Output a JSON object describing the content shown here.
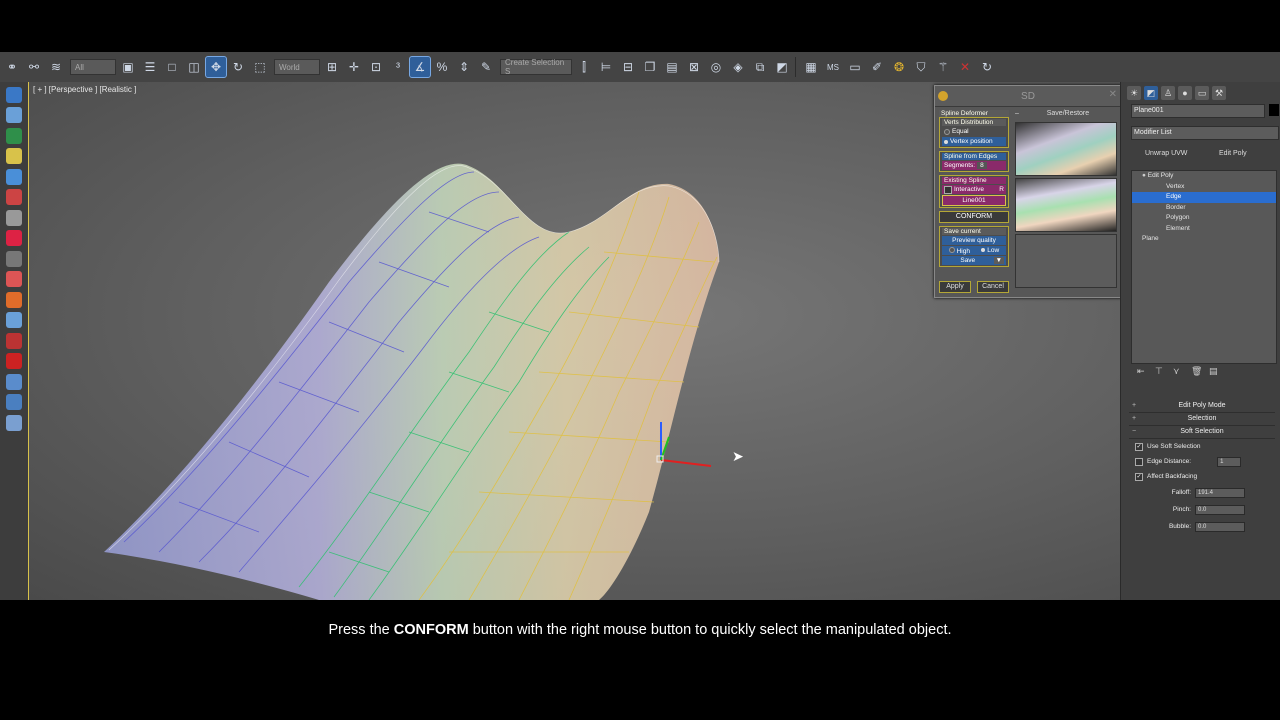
{
  "toolbar": {
    "selection_filter": "All",
    "ref_coord": "World",
    "named_selection": "Create Selection S",
    "icons": [
      "link-icon",
      "unlink-icon",
      "bind-icon",
      "select-icon",
      "select-by-name-icon",
      "rect-region-icon",
      "window-crossing-icon",
      "move-icon",
      "rotate-icon",
      "scale-icon",
      "pivot-icon",
      "snap-icon",
      "angle-snap-icon",
      "percent-snap-icon",
      "spinner-snap-icon",
      "edit-named-icon",
      "mirror-icon",
      "align-icon",
      "layers-icon",
      "graphite-icon",
      "curve-editor-icon",
      "schematic-icon",
      "material-editor-icon",
      "render-setup-icon",
      "render-frame-icon",
      "render-icon"
    ]
  },
  "viewport": {
    "label": "[ + ] [Perspective ] [Realistic ]"
  },
  "sd_window": {
    "title": "SD",
    "spline_deformer": "Spline Deformer",
    "verts_distribution": "Verts Distribution",
    "equal": "Equal",
    "vertex_position": "Vertex position",
    "spline_from_edges": "Spline from Edges",
    "segments": "Segments:",
    "segments_value": "8",
    "existing_spline": "Existing Spline",
    "interactive": "Interactive",
    "r_label": "R",
    "line_name": "Line001",
    "conform": "CONFORM",
    "save_current": "Save current",
    "preview_quality": "Preview quality",
    "high": "High",
    "low": "Low",
    "save": "Save",
    "apply": "Apply",
    "cancel": "Cancel",
    "save_restore": "Save/Restore",
    "minus": "–"
  },
  "command_panel": {
    "object_name": "Plane001",
    "modifier_list": "Modifier List",
    "unwrap_uvw": "Unwrap UVW",
    "edit_poly": "Edit Poly",
    "stack": {
      "edit_poly": "Edit Poly",
      "vertex": "Vertex",
      "edge": "Edge",
      "border": "Border",
      "polygon": "Polygon",
      "element": "Element",
      "plane": "Plane"
    },
    "rollouts": {
      "edit_poly_mode": "Edit Poly Mode",
      "selection": "Selection",
      "soft_selection": "Soft Selection"
    },
    "soft": {
      "use_soft_selection": "Use Soft Selection",
      "edge_distance": "Edge Distance:",
      "edge_distance_value": "1",
      "affect_backfacing": "Affect Backfacing",
      "falloff": "Falloff:",
      "falloff_value": "191.4",
      "pinch": "Pinch:",
      "pinch_value": "0.0",
      "bubble": "Bubble:",
      "bubble_value": "0.0"
    }
  },
  "subtitle": {
    "pre": "Press the ",
    "bold": "CONFORM",
    "post": " button with the right mouse button to quickly select the manipulated object."
  }
}
